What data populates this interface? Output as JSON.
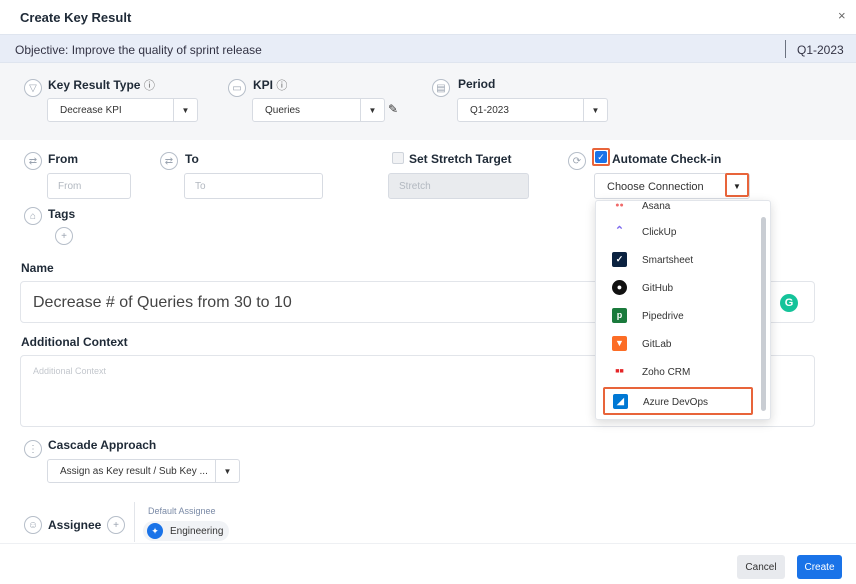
{
  "dialog": {
    "title": "Create Key Result",
    "close_glyph": "×"
  },
  "objective": {
    "label": "Objective: Improve the quality of sprint release",
    "quarter": "Q1-2023"
  },
  "key_result_type": {
    "label": "Key Result Type",
    "info": "ⓘ",
    "value": "Decrease KPI"
  },
  "kpi": {
    "label": "KPI",
    "info": "ⓘ",
    "value": "Queries"
  },
  "period": {
    "label": "Period",
    "value": "Q1-2023"
  },
  "from": {
    "label": "From",
    "placeholder": "From"
  },
  "to": {
    "label": "To",
    "placeholder": "To"
  },
  "stretch": {
    "label": "Set Stretch Target",
    "placeholder": "Stretch",
    "checked": false
  },
  "automate": {
    "label": "Automate Check-in",
    "checked": true,
    "connection_placeholder": "Choose Connection"
  },
  "tags": {
    "label": "Tags"
  },
  "name": {
    "label": "Name",
    "value": "Decrease # of Queries from 30 to 10"
  },
  "context": {
    "label": "Additional Context",
    "placeholder": "Additional Context"
  },
  "cascade": {
    "label": "Cascade Approach",
    "value": "Assign as Key result / Sub Key ..."
  },
  "assignee": {
    "label": "Assignee",
    "default_label": "Default Assignee",
    "value": "Engineering"
  },
  "connections": [
    {
      "name": "Asana",
      "icon": "asana-icon",
      "color": "#f06a6a"
    },
    {
      "name": "ClickUp",
      "icon": "clickup-icon",
      "color": "#7b68ee"
    },
    {
      "name": "Smartsheet",
      "icon": "smartsheet-icon",
      "color": "#0b2240"
    },
    {
      "name": "GitHub",
      "icon": "github-icon",
      "color": "#111111"
    },
    {
      "name": "Pipedrive",
      "icon": "pipedrive-icon",
      "color": "#1a7a3c"
    },
    {
      "name": "GitLab",
      "icon": "gitlab-icon",
      "color": "#fc6d26"
    },
    {
      "name": "Zoho CRM",
      "icon": "zoho-icon",
      "color": "#e42527"
    },
    {
      "name": "Azure DevOps",
      "icon": "azure-devops-icon",
      "color": "#0078d4"
    }
  ],
  "highlight_color": "#e8643a",
  "accent_color": "#1a73e8",
  "footer": {
    "cancel": "Cancel",
    "create": "Create"
  }
}
